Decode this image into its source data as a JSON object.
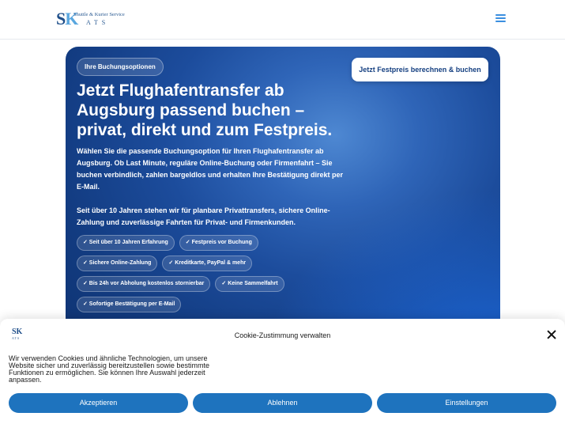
{
  "header": {
    "logo_letters_s": "S",
    "logo_letters_k": "K",
    "logo_tagline": "Shuttle & Kurier Service",
    "logo_ats": "ATS",
    "menu_icon": "hamburger-menu-icon",
    "menu_color": "#3b8fe0"
  },
  "hero": {
    "badge": "Ihre Buchungsoptionen",
    "cta": "Jetzt Festpreis berechnen & buchen",
    "title": "Jetzt Flughafentransfer ab Augsburg passend buchen – privat, direkt und zum Festpreis.",
    "paragraph1": "Wählen Sie die passende Buchungsoption für Ihren Flughafentransfer ab Augsburg. Ob Last Minute, reguläre Online-Buchung oder Firmenfahrt – Sie buchen verbindlich, zahlen bargeldlos und erhalten Ihre Bestätigung direkt per E-Mail.",
    "paragraph2": "Seit über 10 Jahren stehen wir für planbare Privattransfers, sichere Online-Zahlung und zuverlässige Fahrten für Privat- und Firmenkunden.",
    "chips": [
      "✓ Seit über 10 Jahren Erfahrung",
      "✓ Festpreis vor Buchung",
      "✓ Sichere Online-Zahlung",
      "✓ Kreditkarte, PayPal & mehr",
      "✓ Bis 24h vor Abholung kostenlos stornierbar",
      "✓ Keine Sammelfahrt",
      "✓ Sofortige Bestätigung per E-Mail"
    ],
    "background_color": "#1c4c9c"
  },
  "cookie": {
    "logo_letters": "SK",
    "logo_ats": "ATS",
    "title": "Cookie-Zustimmung verwalten",
    "text": "Wir verwenden Cookies und ähnliche Technologien, um unsere Website sicher und zuverlässig bereitzustellen sowie bestimmte Funktionen zu ermöglichen. Sie können Ihre Auswahl jederzeit anpassen.",
    "accept": "Akzeptieren",
    "decline": "Ablehnen",
    "settings": "Einstellungen",
    "button_color": "#1e73be",
    "close_icon": "close-icon"
  }
}
